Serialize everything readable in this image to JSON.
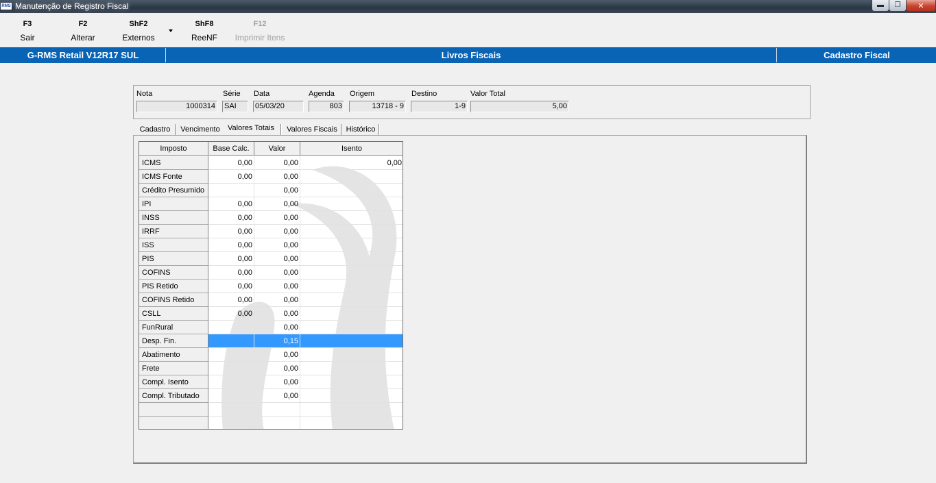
{
  "window": {
    "app_icon_text": "RMS",
    "title": "Manutenção de Registro Fiscal",
    "buttons": [
      "minimize",
      "restore",
      "close"
    ]
  },
  "toolbar": {
    "buttons": [
      {
        "key": "F3",
        "label": "Sair",
        "enabled": true
      },
      {
        "key": "F2",
        "label": "Alterar",
        "enabled": true
      },
      {
        "key": "ShF2",
        "label": "Externos",
        "enabled": true,
        "has_dropdown": true
      },
      {
        "key": "ShF8",
        "label": "ReeNF",
        "enabled": true
      },
      {
        "key": "F12",
        "label": "Imprimir Itens",
        "enabled": false
      }
    ]
  },
  "header_bar": {
    "system": "G-RMS Retail V12R17 SUL",
    "module": "Livros Fiscais",
    "section": "Cadastro Fiscal",
    "color": "#0a64b5"
  },
  "form": {
    "nota": {
      "label": "Nota",
      "value": "1000314"
    },
    "serie": {
      "label": "Série",
      "value": "SAI"
    },
    "data": {
      "label": "Data",
      "value": "05/03/20"
    },
    "agenda": {
      "label": "Agenda",
      "value": "803"
    },
    "origem": {
      "label": "Origem",
      "value": "13718 - 9"
    },
    "destino": {
      "label": "Destino",
      "value": "1-9"
    },
    "valor_total": {
      "label": "Valor Total",
      "value": "5,00"
    }
  },
  "tabs": [
    {
      "label": "Cadastro",
      "active": false
    },
    {
      "label": "Vencimento",
      "active": false
    },
    {
      "label": "Valores Totais",
      "active": true
    },
    {
      "label": "Valores Fiscais",
      "active": false
    },
    {
      "label": "Histórico",
      "active": false
    }
  ],
  "grid": {
    "columns": [
      "Imposto",
      "Base Calc.",
      "Valor",
      "Isento"
    ],
    "selection_color": "#3399ff",
    "rows": [
      {
        "imposto": "ICMS",
        "base": "0,00",
        "valor": "0,00",
        "isento": "0,00"
      },
      {
        "imposto": "ICMS Fonte",
        "base": "0,00",
        "valor": "0,00",
        "isento": ""
      },
      {
        "imposto": "Crédito Presumido",
        "base": "",
        "valor": "0,00",
        "isento": ""
      },
      {
        "imposto": "IPI",
        "base": "0,00",
        "valor": "0,00",
        "isento": ""
      },
      {
        "imposto": "INSS",
        "base": "0,00",
        "valor": "0,00",
        "isento": ""
      },
      {
        "imposto": "IRRF",
        "base": "0,00",
        "valor": "0,00",
        "isento": ""
      },
      {
        "imposto": "ISS",
        "base": "0,00",
        "valor": "0,00",
        "isento": ""
      },
      {
        "imposto": "PIS",
        "base": "0,00",
        "valor": "0,00",
        "isento": ""
      },
      {
        "imposto": "COFINS",
        "base": "0,00",
        "valor": "0,00",
        "isento": ""
      },
      {
        "imposto": "PIS Retido",
        "base": "0,00",
        "valor": "0,00",
        "isento": ""
      },
      {
        "imposto": "COFINS Retido",
        "base": "0,00",
        "valor": "0,00",
        "isento": ""
      },
      {
        "imposto": "CSLL",
        "base": "0,00",
        "valor": "0,00",
        "isento": ""
      },
      {
        "imposto": "FunRural",
        "base": "",
        "valor": "0,00",
        "isento": ""
      },
      {
        "imposto": "Desp. Fin.",
        "base": "",
        "valor": "0,15",
        "isento": "",
        "selected": true
      },
      {
        "imposto": "Abatimento",
        "base": "",
        "valor": "0,00",
        "isento": ""
      },
      {
        "imposto": "Frete",
        "base": "",
        "valor": "0,00",
        "isento": ""
      },
      {
        "imposto": "Compl. Isento",
        "base": "",
        "valor": "0,00",
        "isento": ""
      },
      {
        "imposto": "Compl. Tributado",
        "base": "",
        "valor": "0,00",
        "isento": ""
      },
      {
        "imposto": "",
        "base": "",
        "valor": "",
        "isento": ""
      },
      {
        "imposto": "",
        "base": "",
        "valor": "",
        "isento": ""
      }
    ]
  }
}
